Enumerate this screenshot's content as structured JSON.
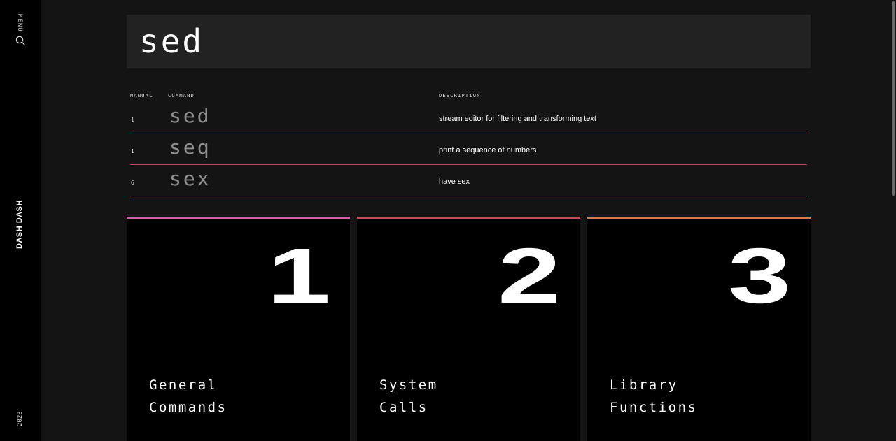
{
  "sidebar": {
    "menu_label": "MENU",
    "search_icon": "search-icon",
    "brand": "DASH DASH",
    "year": "2023"
  },
  "search": {
    "value": "sed",
    "placeholder": ""
  },
  "results": {
    "headers": {
      "manual": "MANUAL",
      "command": "COMMAND",
      "description": "DESCRIPTION"
    },
    "rows": [
      {
        "manual": "1",
        "command": "sed",
        "description": "stream editor for filtering and transforming text"
      },
      {
        "manual": "1",
        "command": "seq",
        "description": "print a sequence of numbers"
      },
      {
        "manual": "6",
        "command": "sex",
        "description": "have sex"
      }
    ],
    "row_line_colors": [
      "#aa4e86",
      "#ad4a62",
      "#4fa3a6"
    ]
  },
  "sections": [
    {
      "number": "1",
      "title_line1": "General",
      "title_line2": "Commands",
      "accent": "#d35fa6"
    },
    {
      "number": "2",
      "title_line1": "System",
      "title_line2": "Calls",
      "accent": "#c74a57"
    },
    {
      "number": "3",
      "title_line1": "Library",
      "title_line2": "Functions",
      "accent": "#e07a45"
    }
  ],
  "colors": {
    "background": "#141414",
    "sidebar": "#000000",
    "search_box": "#222222",
    "card": "#000000"
  }
}
